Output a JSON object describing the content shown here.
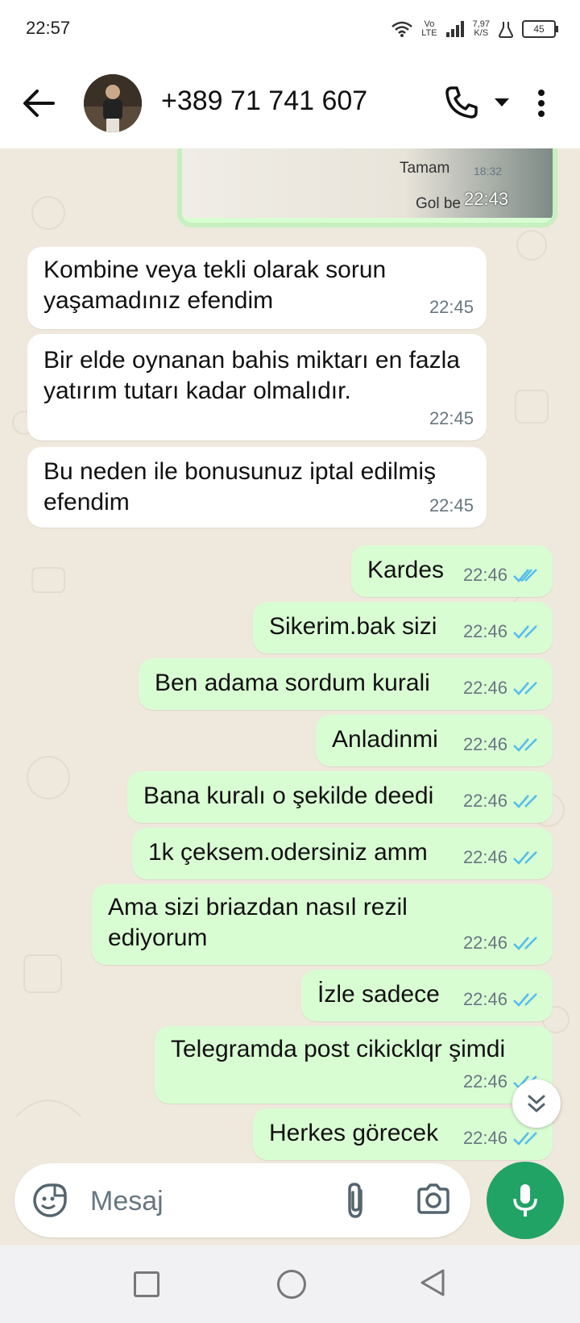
{
  "status_bar": {
    "time": "22:57",
    "net_speed_value": "7,97",
    "net_speed_unit": "K/S",
    "volte_top": "Vo",
    "volte_bottom": "LTE",
    "battery": "45"
  },
  "header": {
    "contact_name": "+389 71 741 607"
  },
  "quoted": {
    "line1": "Tamam",
    "line1_time": "18:32",
    "line2": "Gol be",
    "overlay_time": "22:43"
  },
  "messages": [
    {
      "text": "Kombine veya tekli olarak sorun yaşamadınız efendim",
      "time": "22:45",
      "direction": "in"
    },
    {
      "text": " Bir elde oynanan bahis miktarı en fazla yatırım tutarı kadar olmalıdır.",
      "time": "22:45",
      "direction": "in"
    },
    {
      "text": "Bu neden ile bonusunuz iptal edilmiş efendim",
      "time": "22:45",
      "direction": "in"
    },
    {
      "text": "Kardes",
      "time": "22:46",
      "direction": "out"
    },
    {
      "text": "Sikerim.bak sizi",
      "time": "22:46",
      "direction": "out"
    },
    {
      "text": "Ben adama sordum kurali",
      "time": "22:46",
      "direction": "out"
    },
    {
      "text": "Anladinmi",
      "time": "22:46",
      "direction": "out"
    },
    {
      "text": "Bana kuralı o şekilde deedi",
      "time": "22:46",
      "direction": "out"
    },
    {
      "text": "1k çeksem.odersiniz amm",
      "time": "22:46",
      "direction": "out"
    },
    {
      "text": "Ama sizi briazdan nasıl rezil ediyorum",
      "time": "22:46",
      "direction": "out"
    },
    {
      "text": "İzle sadece",
      "time": "22:46",
      "direction": "out"
    },
    {
      "text": "Telegramda post cikicklqr şimdi",
      "time": "22:46",
      "direction": "out"
    },
    {
      "text": "Herkes görecek",
      "time": "22:46",
      "direction": "out"
    }
  ],
  "composer": {
    "placeholder": "Mesaj"
  },
  "colors": {
    "outgoing": "#d9fdd3",
    "incoming": "#ffffff",
    "accent": "#21a365",
    "read_ticks": "#53bdeb"
  },
  "icons": [
    "back-arrow-icon",
    "phone-icon",
    "chevron-down-icon",
    "more-vert-icon",
    "sticker-icon",
    "attach-icon",
    "camera-icon",
    "mic-icon",
    "double-chevron-down-icon"
  ]
}
